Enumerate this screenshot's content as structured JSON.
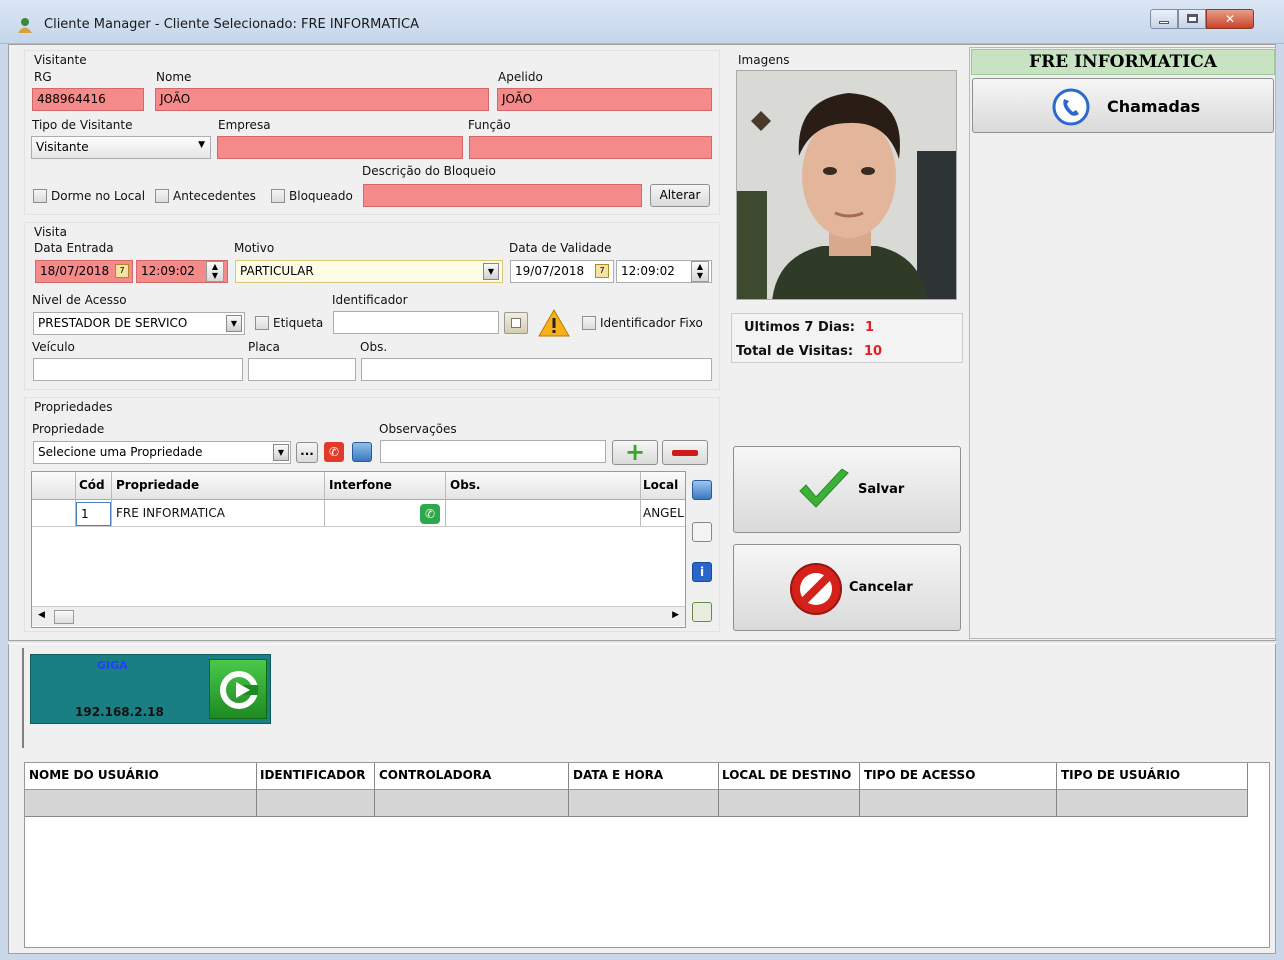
{
  "window": {
    "title": "Cliente Manager - Cliente Selecionado: FRE INFORMATICA"
  },
  "visitante": {
    "section": "Visitante",
    "rg_label": "RG",
    "rg": "488964416",
    "nome_label": "Nome",
    "nome": "JOÃO",
    "apelido_label": "Apelido",
    "apelido": "JOÃO",
    "tipo_label": "Tipo de Visitante",
    "tipo": "Visitante",
    "empresa_label": "Empresa",
    "funcao_label": "Função",
    "descricao_label": "Descrição do Bloqueio",
    "dorme": "Dorme no Local",
    "antecedentes": "Antecedentes",
    "bloqueado": "Bloqueado",
    "alterar": "Alterar"
  },
  "visita": {
    "section": "Visita",
    "entrada_label": "Data Entrada",
    "entrada_data": "18/07/2018",
    "entrada_hora": "12:09:02",
    "motivo_label": "Motivo",
    "motivo": "PARTICULAR",
    "validade_label": "Data de Validade",
    "validade_data": "19/07/2018",
    "validade_hora": "12:09:02",
    "nivel_label": "Nivel de Acesso",
    "nivel": "PRESTADOR DE SERVICO",
    "etiqueta": "Etiqueta",
    "identificador_label": "Identificador",
    "identificador_fixo": "Identificador Fixo",
    "veiculo_label": "Veículo",
    "placa_label": "Placa",
    "obs_label": "Obs."
  },
  "propriedades": {
    "section": "Propriedades",
    "prop_label": "Propriedade",
    "prop_value": "Selecione uma Propriedade",
    "dots": "...",
    "obs_label": "Observações",
    "columns": [
      "Cód",
      "Propriedade",
      "Interfone",
      "Obs.",
      "Local"
    ],
    "rows": [
      {
        "cod": "1",
        "propriedade": "FRE INFORMATICA",
        "obs": "",
        "local": "ANGEL"
      }
    ]
  },
  "imagens": {
    "label": "Imagens",
    "ultimos_label": "Ultimos 7 Dias:",
    "ultimos": "1",
    "total_label": "Total de Visitas:",
    "total": "10"
  },
  "actions": {
    "salvar": "Salvar",
    "cancelar": "Cancelar"
  },
  "right": {
    "cliente": "FRE INFORMATICA",
    "chamadas": "Chamadas"
  },
  "device": {
    "name": "GIGA",
    "ip": "192.168.2.18"
  },
  "log": {
    "columns": [
      "NOME DO USUÁRIO",
      "IDENTIFICADOR",
      "CONTROLADORA",
      "DATA E HORA",
      "LOCAL DE DESTINO",
      "TIPO DE ACESSO",
      "TIPO DE USUÁRIO"
    ]
  },
  "colors": {
    "required": "#f58a8a",
    "client_header": "#c7e3c2",
    "device_tile": "#1a7f83",
    "count": "#e02020"
  }
}
